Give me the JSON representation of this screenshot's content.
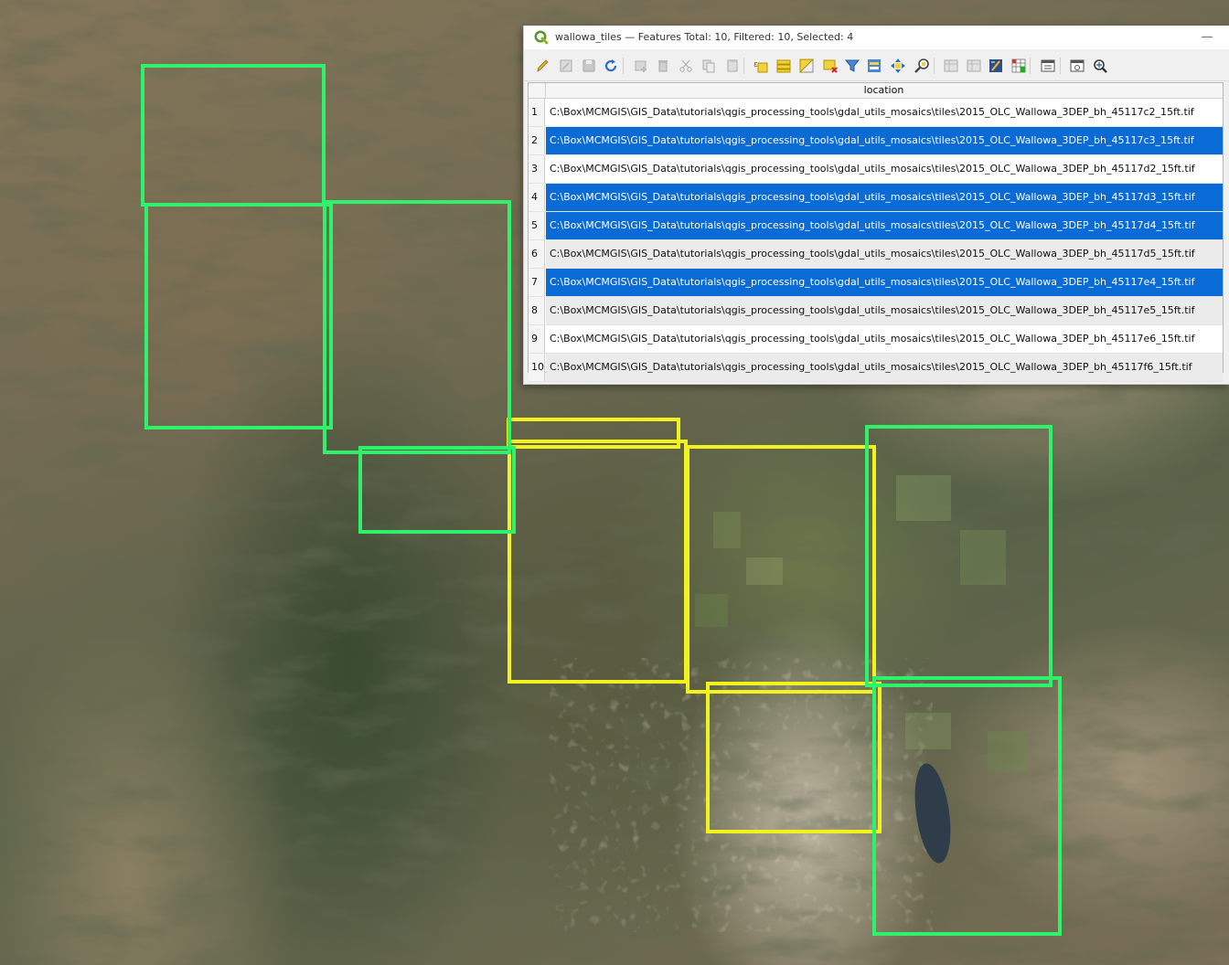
{
  "window": {
    "title": "wallowa_tiles — Features Total: 10, Filtered: 10, Selected: 4",
    "minimize_glyph": "—"
  },
  "toolbar": {
    "icons": [
      "toggle-editing-icon",
      "toggle-multi-edit-icon",
      "save-edits-icon",
      "reload-table-icon",
      "add-feature-icon",
      "delete-selected-icon",
      "cut-icon",
      "copy-icon",
      "paste-icon",
      "select-by-expression-icon",
      "select-all-icon",
      "invert-selection-icon",
      "deselect-all-icon",
      "filter-select-icon",
      "move-selection-to-top-icon",
      "pan-to-selected-icon",
      "zoom-to-selected-icon",
      "new-field-icon",
      "delete-field-icon",
      "field-calculator-icon",
      "conditional-formatting-icon",
      "dock-table-icon",
      "actions-icon",
      "organize-columns-icon"
    ]
  },
  "table": {
    "column": "location",
    "rows": [
      {
        "num": "1",
        "location": "C:\\Box\\MCMGIS\\GIS_Data\\tutorials\\qgis_processing_tools\\gdal_utils_mosaics\\tiles\\2015_OLC_Wallowa_3DEP_bh_45117c2_15ft.tif",
        "selected": false
      },
      {
        "num": "2",
        "location": "C:\\Box\\MCMGIS\\GIS_Data\\tutorials\\qgis_processing_tools\\gdal_utils_mosaics\\tiles\\2015_OLC_Wallowa_3DEP_bh_45117c3_15ft.tif",
        "selected": true
      },
      {
        "num": "3",
        "location": "C:\\Box\\MCMGIS\\GIS_Data\\tutorials\\qgis_processing_tools\\gdal_utils_mosaics\\tiles\\2015_OLC_Wallowa_3DEP_bh_45117d2_15ft.tif",
        "selected": false
      },
      {
        "num": "4",
        "location": "C:\\Box\\MCMGIS\\GIS_Data\\tutorials\\qgis_processing_tools\\gdal_utils_mosaics\\tiles\\2015_OLC_Wallowa_3DEP_bh_45117d3_15ft.tif",
        "selected": true
      },
      {
        "num": "5",
        "location": "C:\\Box\\MCMGIS\\GIS_Data\\tutorials\\qgis_processing_tools\\gdal_utils_mosaics\\tiles\\2015_OLC_Wallowa_3DEP_bh_45117d4_15ft.tif",
        "selected": true
      },
      {
        "num": "6",
        "location": "C:\\Box\\MCMGIS\\GIS_Data\\tutorials\\qgis_processing_tools\\gdal_utils_mosaics\\tiles\\2015_OLC_Wallowa_3DEP_bh_45117d5_15ft.tif",
        "selected": false
      },
      {
        "num": "7",
        "location": "C:\\Box\\MCMGIS\\GIS_Data\\tutorials\\qgis_processing_tools\\gdal_utils_mosaics\\tiles\\2015_OLC_Wallowa_3DEP_bh_45117e4_15ft.tif",
        "selected": true
      },
      {
        "num": "8",
        "location": "C:\\Box\\MCMGIS\\GIS_Data\\tutorials\\qgis_processing_tools\\gdal_utils_mosaics\\tiles\\2015_OLC_Wallowa_3DEP_bh_45117e5_15ft.tif",
        "selected": false
      },
      {
        "num": "9",
        "location": "C:\\Box\\MCMGIS\\GIS_Data\\tutorials\\qgis_processing_tools\\gdal_utils_mosaics\\tiles\\2015_OLC_Wallowa_3DEP_bh_45117e6_15ft.tif",
        "selected": false
      },
      {
        "num": "10",
        "location": "C:\\Box\\MCMGIS\\GIS_Data\\tutorials\\qgis_processing_tools\\gdal_utils_mosaics\\tiles\\2015_OLC_Wallowa_3DEP_bh_45117f6_15ft.tif",
        "selected": false
      }
    ]
  },
  "map": {
    "tile_color_unselected": "#2ef26a",
    "tile_color_selected": "#f2f21e",
    "selection_color": "#0a6ad6"
  }
}
